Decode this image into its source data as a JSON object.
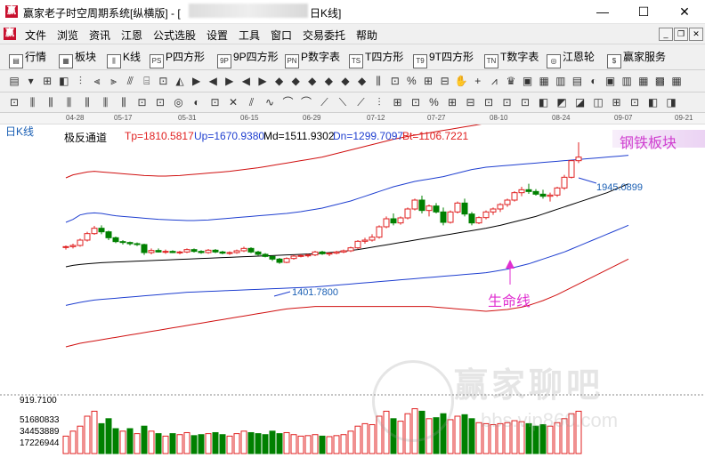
{
  "window": {
    "title_prefix": "赢家老子时空周期系统[纵横版] - [",
    "title_suffix": "日K线]",
    "app_icon": "赢",
    "min": "—",
    "max": "☐",
    "close": "✕"
  },
  "menu": {
    "logo": "赢",
    "items": [
      "文件",
      "浏览",
      "资讯",
      "江恩",
      "公式选股",
      "设置",
      "工具",
      "窗口",
      "交易委托",
      "帮助"
    ]
  },
  "toolbar1": {
    "items": [
      {
        "icon": "▤",
        "label": "行情"
      },
      {
        "icon": "▦",
        "label": "板块"
      },
      {
        "icon": "⫼",
        "label": "K线"
      },
      {
        "icon": "PS",
        "label": "P四方形"
      },
      {
        "icon": "9P",
        "label": "9P四方形"
      },
      {
        "icon": "PN",
        "label": "P数字表"
      },
      {
        "icon": "TS",
        "label": "T四方形"
      },
      {
        "icon": "T9",
        "label": "9T四方形"
      },
      {
        "icon": "TN",
        "label": "T数字表"
      },
      {
        "icon": "◎",
        "label": "江恩轮"
      },
      {
        "icon": "$",
        "label": "赢家服务"
      }
    ]
  },
  "dates": [
    "04-28",
    "05-17",
    "05-31",
    "06-15",
    "06-29",
    "07-12",
    "07-27",
    "08-10",
    "08-24",
    "09-07",
    "09-21"
  ],
  "chart": {
    "period": "日K线",
    "indicator_name": "极反通道",
    "tp": "Tp=1810.5817",
    "up": "Up=1670.9380",
    "md": "Md=1511.9302",
    "dn": "Dn=1299.7097",
    "bt": "Bt=1106.7221",
    "sector": "钢铁板块",
    "high_label": "1945.0899",
    "low_label": "1401.7800",
    "lifeline_label": "生命线",
    "vol_top": "919.7100",
    "vol_labels": [
      "51680833",
      "34453889",
      "17226944"
    ],
    "watermark": "赢家聊吧",
    "watermark_url": "bbs.vip860.com",
    "colors": {
      "up": "#e02020",
      "down": "#008000",
      "mid": "#000000",
      "inner": "#1f3fd0",
      "outer": "#d01010"
    }
  },
  "chart_data": {
    "type": "candlestick",
    "ohlc": [
      [
        1395,
        1402,
        1388,
        1398
      ],
      [
        1398,
        1408,
        1392,
        1402
      ],
      [
        1402,
        1425,
        1398,
        1420
      ],
      [
        1420,
        1448,
        1415,
        1442
      ],
      [
        1442,
        1468,
        1438,
        1460
      ],
      [
        1460,
        1470,
        1440,
        1448
      ],
      [
        1448,
        1452,
        1420,
        1428
      ],
      [
        1428,
        1432,
        1410,
        1415
      ],
      [
        1415,
        1420,
        1405,
        1412
      ],
      [
        1412,
        1415,
        1402,
        1408
      ],
      [
        1408,
        1412,
        1400,
        1405
      ],
      [
        1405,
        1408,
        1370,
        1378
      ],
      [
        1378,
        1392,
        1372,
        1385
      ],
      [
        1385,
        1392,
        1378,
        1380
      ],
      [
        1380,
        1388,
        1374,
        1382
      ],
      [
        1382,
        1386,
        1376,
        1378
      ],
      [
        1378,
        1384,
        1372,
        1380
      ],
      [
        1380,
        1392,
        1376,
        1388
      ],
      [
        1388,
        1392,
        1378,
        1382
      ],
      [
        1382,
        1386,
        1374,
        1378
      ],
      [
        1378,
        1390,
        1374,
        1386
      ],
      [
        1386,
        1390,
        1376,
        1380
      ],
      [
        1380,
        1384,
        1372,
        1376
      ],
      [
        1376,
        1382,
        1370,
        1378
      ],
      [
        1378,
        1388,
        1374,
        1384
      ],
      [
        1384,
        1398,
        1380,
        1392
      ],
      [
        1392,
        1396,
        1376,
        1380
      ],
      [
        1380,
        1384,
        1368,
        1372
      ],
      [
        1372,
        1376,
        1362,
        1365
      ],
      [
        1365,
        1368,
        1350,
        1356
      ],
      [
        1356,
        1360,
        1340,
        1345
      ],
      [
        1345,
        1362,
        1342,
        1358
      ],
      [
        1358,
        1370,
        1354,
        1366
      ],
      [
        1366,
        1372,
        1362,
        1368
      ],
      [
        1368,
        1374,
        1362,
        1370
      ],
      [
        1370,
        1384,
        1366,
        1380
      ],
      [
        1380,
        1384,
        1370,
        1374
      ],
      [
        1374,
        1378,
        1366,
        1376
      ],
      [
        1376,
        1384,
        1372,
        1380
      ],
      [
        1380,
        1388,
        1376,
        1384
      ],
      [
        1384,
        1398,
        1380,
        1394
      ],
      [
        1394,
        1420,
        1390,
        1416
      ],
      [
        1416,
        1428,
        1408,
        1420
      ],
      [
        1420,
        1440,
        1415,
        1430
      ],
      [
        1430,
        1470,
        1425,
        1465
      ],
      [
        1465,
        1500,
        1460,
        1492
      ],
      [
        1492,
        1510,
        1470,
        1478
      ],
      [
        1478,
        1500,
        1472,
        1495
      ],
      [
        1495,
        1530,
        1490,
        1525
      ],
      [
        1525,
        1560,
        1520,
        1555
      ],
      [
        1555,
        1570,
        1510,
        1520
      ],
      [
        1520,
        1540,
        1500,
        1535
      ],
      [
        1535,
        1545,
        1510,
        1515
      ],
      [
        1515,
        1530,
        1470,
        1480
      ],
      [
        1480,
        1520,
        1476,
        1515
      ],
      [
        1515,
        1550,
        1510,
        1545
      ],
      [
        1545,
        1560,
        1500,
        1508
      ],
      [
        1508,
        1515,
        1470,
        1478
      ],
      [
        1478,
        1500,
        1474,
        1496
      ],
      [
        1496,
        1520,
        1490,
        1515
      ],
      [
        1515,
        1530,
        1505,
        1525
      ],
      [
        1525,
        1545,
        1515,
        1540
      ],
      [
        1540,
        1560,
        1532,
        1555
      ],
      [
        1555,
        1585,
        1550,
        1580
      ],
      [
        1580,
        1600,
        1568,
        1590
      ],
      [
        1590,
        1610,
        1576,
        1584
      ],
      [
        1584,
        1592,
        1570,
        1575
      ],
      [
        1575,
        1590,
        1560,
        1568
      ],
      [
        1568,
        1580,
        1550,
        1572
      ],
      [
        1572,
        1600,
        1566,
        1596
      ],
      [
        1596,
        1640,
        1590,
        1632
      ],
      [
        1632,
        1690,
        1628,
        1688
      ],
      [
        1688,
        1750,
        1680,
        1700
      ]
    ],
    "lifeline": [
      1330,
      1335,
      1338,
      1340,
      1342,
      1344,
      1345,
      1346,
      1347,
      1348,
      1349,
      1350,
      1351,
      1352,
      1353,
      1354,
      1355,
      1356,
      1357,
      1358,
      1359,
      1360,
      1361,
      1362,
      1363,
      1364,
      1365,
      1366,
      1367,
      1368,
      1369,
      1370,
      1371,
      1372,
      1373,
      1374,
      1376,
      1378,
      1380,
      1382,
      1385,
      1388,
      1392,
      1396,
      1400,
      1404,
      1408,
      1412,
      1416,
      1420,
      1424,
      1428,
      1432,
      1436,
      1440,
      1444,
      1448,
      1452,
      1456,
      1460,
      1465,
      1470,
      1476,
      1482,
      1488,
      1494,
      1500,
      1508,
      1516,
      1524,
      1532,
      1540,
      1548,
      1556,
      1564,
      1572,
      1580,
      1590,
      1600,
      1610
    ],
    "upper_blue": [
      1480,
      1490,
      1505,
      1510,
      1512,
      1510,
      1506,
      1502,
      1500,
      1498,
      1496,
      1494,
      1492,
      1490,
      1489,
      1488,
      1487,
      1486,
      1486,
      1487,
      1488,
      1490,
      1492,
      1494,
      1496,
      1498,
      1500,
      1502,
      1504,
      1506,
      1508,
      1510,
      1513,
      1516,
      1520,
      1524,
      1528,
      1534,
      1540,
      1546,
      1552,
      1560,
      1568,
      1576,
      1584,
      1592,
      1600,
      1606,
      1612,
      1618,
      1622,
      1626,
      1630,
      1634,
      1640,
      1646,
      1652,
      1658,
      1662,
      1666,
      1668,
      1670,
      1672,
      1674,
      1676,
      1678,
      1680,
      1682,
      1684,
      1686,
      1688,
      1690,
      1692,
      1694,
      1696,
      1698,
      1700,
      1702,
      1704,
      1706
    ],
    "upper_red": [
      1630,
      1640,
      1645,
      1650,
      1652,
      1650,
      1648,
      1646,
      1644,
      1642,
      1640,
      1638,
      1637,
      1636,
      1636,
      1637,
      1638,
      1640,
      1642,
      1644,
      1646,
      1648,
      1650,
      1652,
      1655,
      1658,
      1661,
      1664,
      1668,
      1672,
      1676,
      1680,
      1684,
      1688,
      1692,
      1696,
      1700,
      1706,
      1712,
      1718,
      1724,
      1730,
      1736,
      1742,
      1748,
      1754,
      1760,
      1765,
      1770,
      1774,
      1778,
      1782,
      1786,
      1790,
      1794,
      1798,
      1802,
      1806,
      1810,
      1814,
      1818,
      1822,
      1826,
      1830,
      1834,
      1838,
      1840,
      1842,
      1844,
      1846,
      1848,
      1850,
      1852,
      1854,
      1856,
      1858,
      1860,
      1862,
      1864,
      1866
    ],
    "lower_blue": [
      1200,
      1205,
      1210,
      1214,
      1218,
      1220,
      1222,
      1224,
      1226,
      1228,
      1230,
      1232,
      1234,
      1236,
      1238,
      1240,
      1242,
      1244,
      1245,
      1246,
      1247,
      1248,
      1249,
      1250,
      1251,
      1252,
      1253,
      1254,
      1255,
      1256,
      1257,
      1258,
      1259,
      1260,
      1261,
      1262,
      1264,
      1266,
      1268,
      1270,
      1272,
      1274,
      1276,
      1278,
      1280,
      1282,
      1284,
      1286,
      1288,
      1290,
      1292,
      1294,
      1296,
      1298,
      1300,
      1302,
      1304,
      1306,
      1308,
      1310,
      1314,
      1318,
      1322,
      1328,
      1334,
      1340,
      1348,
      1356,
      1364,
      1372,
      1380,
      1390,
      1400,
      1410,
      1420,
      1430,
      1440,
      1450,
      1460,
      1470
    ],
    "lower_red": [
      1060,
      1066,
      1072,
      1076,
      1080,
      1084,
      1088,
      1092,
      1096,
      1100,
      1104,
      1108,
      1112,
      1116,
      1120,
      1124,
      1128,
      1132,
      1136,
      1140,
      1144,
      1148,
      1152,
      1156,
      1160,
      1164,
      1168,
      1172,
      1176,
      1180,
      1184,
      1188,
      1190,
      1192,
      1194,
      1196,
      1196,
      1196,
      1196,
      1196,
      1196,
      1196,
      1196,
      1196,
      1196,
      1196,
      1196,
      1196,
      1196,
      1196,
      1196,
      1196,
      1194,
      1192,
      1190,
      1188,
      1186,
      1184,
      1182,
      1180,
      1182,
      1184,
      1186,
      1190,
      1194,
      1200,
      1208,
      1216,
      1226,
      1236,
      1248,
      1260,
      1272,
      1284,
      1296,
      1308,
      1320,
      1332,
      1344,
      1356
    ],
    "volume": [
      [
        0.35,
        1
      ],
      [
        0.45,
        1
      ],
      [
        0.55,
        1
      ],
      [
        0.75,
        1
      ],
      [
        0.85,
        1
      ],
      [
        0.6,
        0
      ],
      [
        0.7,
        0
      ],
      [
        0.5,
        0
      ],
      [
        0.45,
        1
      ],
      [
        0.5,
        0
      ],
      [
        0.4,
        1
      ],
      [
        0.55,
        0
      ],
      [
        0.45,
        1
      ],
      [
        0.4,
        0
      ],
      [
        0.35,
        1
      ],
      [
        0.4,
        0
      ],
      [
        0.38,
        1
      ],
      [
        0.42,
        1
      ],
      [
        0.36,
        0
      ],
      [
        0.38,
        0
      ],
      [
        0.4,
        1
      ],
      [
        0.42,
        0
      ],
      [
        0.38,
        0
      ],
      [
        0.35,
        1
      ],
      [
        0.4,
        1
      ],
      [
        0.45,
        1
      ],
      [
        0.42,
        0
      ],
      [
        0.4,
        0
      ],
      [
        0.38,
        0
      ],
      [
        0.45,
        0
      ],
      [
        0.4,
        0
      ],
      [
        0.42,
        1
      ],
      [
        0.38,
        1
      ],
      [
        0.35,
        1
      ],
      [
        0.36,
        1
      ],
      [
        0.38,
        1
      ],
      [
        0.35,
        0
      ],
      [
        0.34,
        1
      ],
      [
        0.36,
        1
      ],
      [
        0.38,
        1
      ],
      [
        0.45,
        1
      ],
      [
        0.55,
        1
      ],
      [
        0.6,
        1
      ],
      [
        0.58,
        1
      ],
      [
        0.75,
        1
      ],
      [
        0.85,
        1
      ],
      [
        0.7,
        0
      ],
      [
        0.65,
        1
      ],
      [
        0.8,
        1
      ],
      [
        0.9,
        1
      ],
      [
        0.85,
        0
      ],
      [
        0.7,
        1
      ],
      [
        0.72,
        0
      ],
      [
        0.8,
        0
      ],
      [
        0.68,
        1
      ],
      [
        0.75,
        1
      ],
      [
        0.78,
        0
      ],
      [
        0.7,
        0
      ],
      [
        0.62,
        1
      ],
      [
        0.6,
        1
      ],
      [
        0.58,
        1
      ],
      [
        0.6,
        1
      ],
      [
        0.62,
        1
      ],
      [
        0.66,
        1
      ],
      [
        0.64,
        1
      ],
      [
        0.6,
        0
      ],
      [
        0.55,
        0
      ],
      [
        0.58,
        0
      ],
      [
        0.55,
        1
      ],
      [
        0.62,
        1
      ],
      [
        0.7,
        1
      ],
      [
        0.8,
        1
      ],
      [
        0.85,
        1
      ]
    ]
  }
}
